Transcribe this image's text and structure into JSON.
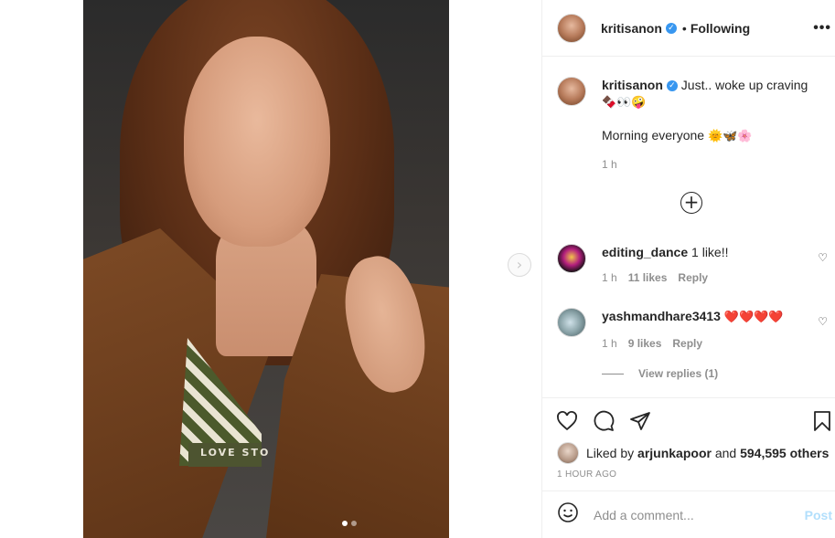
{
  "photo": {
    "band_text": "LOVE STO",
    "dots": 2,
    "active_dot": 0
  },
  "header": {
    "username": "kritisanon",
    "bullet": "•",
    "follow_status": "Following",
    "more": "•••"
  },
  "caption": {
    "username": "kritisanon",
    "text": "Just.. woke up craving",
    "emojis": "🍫👀🤪",
    "line2": "Morning everyone",
    "line2_emojis": "🌞🦋🌸",
    "time": "1 h"
  },
  "load_more": "+",
  "comments": [
    {
      "username": "editing_dance",
      "text": "1 like!!",
      "time": "1 h",
      "likes": "11 likes",
      "reply": "Reply"
    },
    {
      "username": "yashmandhare3413",
      "text": "❤️❤️❤️❤️",
      "time": "1 h",
      "likes": "9 likes",
      "reply": "Reply"
    }
  ],
  "view_replies": "View replies (1)",
  "likes": {
    "prefix": "Liked by",
    "user": "arjunkapoor",
    "and": "and",
    "count": "594,595 others"
  },
  "posted_time": "1 HOUR AGO",
  "add_comment": {
    "placeholder": "Add a comment...",
    "post_label": "Post"
  },
  "icons": {
    "like": "heart-icon",
    "comment": "comment-icon",
    "share": "share-icon",
    "save": "bookmark-icon",
    "emoji": "smiley-icon",
    "next": "chevron-right-icon"
  }
}
